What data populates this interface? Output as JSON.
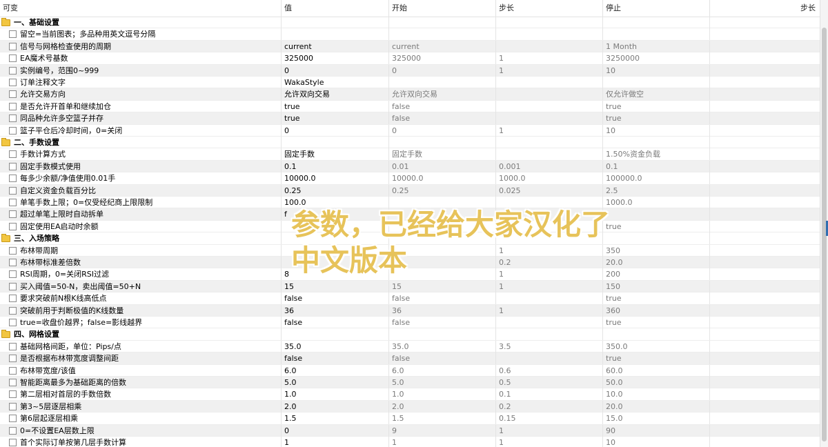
{
  "columns": {
    "name": "可变",
    "value": "值",
    "start": "开始",
    "step": "步长",
    "stop": "停止",
    "extra": "步长"
  },
  "overlay": {
    "line1": "参数，已经给大家汉化了",
    "line2": "中文版本"
  },
  "rows": [
    {
      "type": "group",
      "name": "一、基础设置"
    },
    {
      "name": "留空=当前图表；多品种用英文逗号分隔",
      "value": "",
      "start": "",
      "step": "",
      "stop": ""
    },
    {
      "name": "信号与网格检查使用的周期",
      "value": "current",
      "start": "current",
      "step": "",
      "stop": "1 Month"
    },
    {
      "name": "EA魔术号基数",
      "value": "325000",
      "start": "325000",
      "step": "1",
      "stop": "3250000"
    },
    {
      "name": "实例编号，范围0~999",
      "value": "0",
      "start": "0",
      "step": "1",
      "stop": "10"
    },
    {
      "name": "订单注释文字",
      "value": "WakaStyle",
      "start": "",
      "step": "",
      "stop": ""
    },
    {
      "name": "允许交易方向",
      "value": "允许双向交易",
      "start": "允许双向交易",
      "step": "",
      "stop": "仅允许做空"
    },
    {
      "name": "是否允许开首单和继续加仓",
      "value": "true",
      "start": "false",
      "step": "",
      "stop": "true"
    },
    {
      "name": "同品种允许多空篮子并存",
      "value": "true",
      "start": "false",
      "step": "",
      "stop": "true"
    },
    {
      "name": "篮子平仓后冷却时间，0=关闭",
      "value": "0",
      "start": "0",
      "step": "1",
      "stop": "10"
    },
    {
      "type": "group",
      "name": "二、手数设置"
    },
    {
      "name": "手数计算方式",
      "value": "固定手数",
      "start": "固定手数",
      "step": "",
      "stop": "1.50%资金负载"
    },
    {
      "name": "固定手数模式使用",
      "value": "0.1",
      "start": "0.01",
      "step": "0.001",
      "stop": "0.1"
    },
    {
      "name": "每多少余额/净值使用0.01手",
      "value": "10000.0",
      "start": "10000.0",
      "step": "1000.0",
      "stop": "100000.0"
    },
    {
      "name": "自定义资金负载百分比",
      "value": "0.25",
      "start": "0.25",
      "step": "0.025",
      "stop": "2.5"
    },
    {
      "name": "单笔手数上限；0=仅受经纪商上限限制",
      "value": "100.0",
      "start": "",
      "step": "",
      "stop": "1000.0"
    },
    {
      "name": "超过单笔上限时自动拆单",
      "value": "f",
      "start": "",
      "step": "",
      "stop": ""
    },
    {
      "name": "固定使用EA启动时余额",
      "value": "",
      "start": "",
      "step": "",
      "stop": "true"
    },
    {
      "type": "group",
      "name": "三、入场策略"
    },
    {
      "name": "布林带周期",
      "value": "",
      "start": "",
      "step": "1",
      "stop": "350"
    },
    {
      "name": "布林带标准差倍数",
      "value": "",
      "start": "",
      "step": "0.2",
      "stop": "20.0"
    },
    {
      "name": "RSI周期，0=关闭RSI过滤",
      "value": "8",
      "start": "",
      "step": "1",
      "stop": "200"
    },
    {
      "name": "买入阈值=50-N，卖出阈值=50+N",
      "value": "15",
      "start": "15",
      "step": "1",
      "stop": "150"
    },
    {
      "name": "要求突破前N根K线高低点",
      "value": "false",
      "start": "false",
      "step": "",
      "stop": "true"
    },
    {
      "name": "突破前用于判断极值的K线数量",
      "value": "36",
      "start": "36",
      "step": "1",
      "stop": "360"
    },
    {
      "name": "true=收盘价越界；false=影线越界",
      "value": "false",
      "start": "false",
      "step": "",
      "stop": "true"
    },
    {
      "type": "group",
      "name": "四、网格设置"
    },
    {
      "name": "基础网格间距，单位：Pips/点",
      "value": "35.0",
      "start": "35.0",
      "step": "3.5",
      "stop": "350.0"
    },
    {
      "name": "是否根据布林带宽度调整间距",
      "value": "false",
      "start": "false",
      "step": "",
      "stop": "true"
    },
    {
      "name": "布林带宽度/该值",
      "value": "6.0",
      "start": "6.0",
      "step": "0.6",
      "stop": "60.0"
    },
    {
      "name": "智能距离最多为基础距离的倍数",
      "value": "5.0",
      "start": "5.0",
      "step": "0.5",
      "stop": "50.0"
    },
    {
      "name": "第二层相对首层的手数倍数",
      "value": "1.0",
      "start": "1.0",
      "step": "0.1",
      "stop": "10.0"
    },
    {
      "name": "第3~5层逐层相乘",
      "value": "2.0",
      "start": "2.0",
      "step": "0.2",
      "stop": "20.0"
    },
    {
      "name": "第6层起逐层相乘",
      "value": "1.5",
      "start": "1.5",
      "step": "0.15",
      "stop": "15.0"
    },
    {
      "name": "0=不设置EA层数上限",
      "value": "0",
      "start": "9",
      "step": "1",
      "stop": "90"
    },
    {
      "name": "首个实际订单按第几层手数计算",
      "value": "1",
      "start": "1",
      "step": "1",
      "stop": "10"
    }
  ]
}
